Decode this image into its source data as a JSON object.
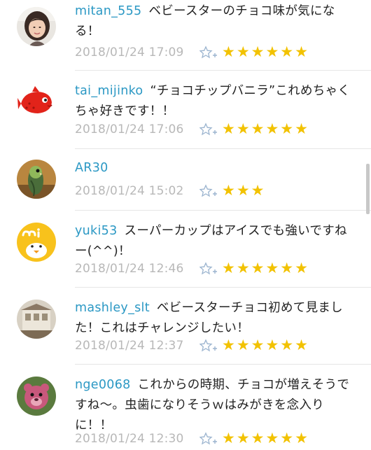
{
  "comments": [
    {
      "user": "mitan_555",
      "text": "ベビースターのチョコ味が気になる！",
      "time": "2018/01/24 17:09",
      "stars": "★★★★★★"
    },
    {
      "user": "tai_mijinko",
      "text": "“チョコチップバニラ”これめちゃくちゃ好きです！！",
      "time": "2018/01/24 17:06",
      "stars": "★★★★★★"
    },
    {
      "user": "AR30",
      "text": "",
      "time": "2018/01/24 15:02",
      "stars": "★★★"
    },
    {
      "user": "yuki53",
      "text": "スーパーカップはアイスでも強いですねー(^^)！",
      "time": "2018/01/24 12:46",
      "stars": "★★★★★★"
    },
    {
      "user": "mashley_slt",
      "text": "ベビースターチョコ初めて見ました！これはチャレンジしたい！",
      "time": "2018/01/24 12:37",
      "stars": "★★★★★★"
    },
    {
      "user": "nge0068",
      "text": "これからの時期、チョコが増えそうですね〜。虫歯になりそうｗはみがきを念入りに！！",
      "time": "2018/01/24 12:30",
      "stars": "★★★★★★"
    }
  ],
  "icons": {
    "favorite_add": "star-plus-icon",
    "rating": "star-icon"
  },
  "colors": {
    "username": "#2b98c4",
    "timestamp": "#b8b8b8",
    "star": "#f2c200",
    "divider": "#e6e6e6"
  }
}
